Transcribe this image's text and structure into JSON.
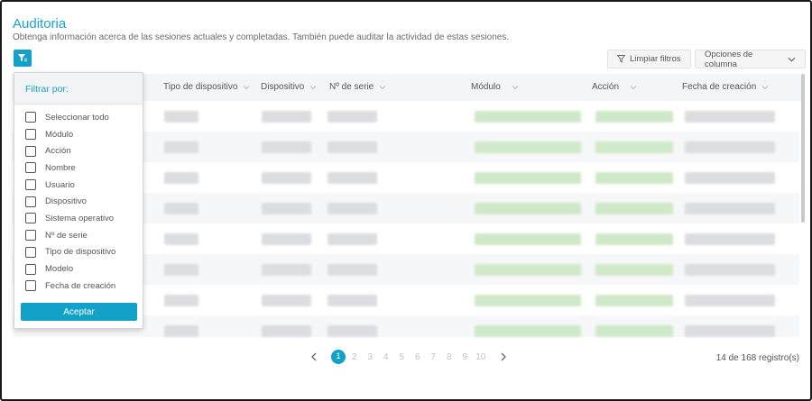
{
  "header": {
    "title": "Auditoria",
    "subtitle": "Obtenga información acerca de las sesiones actuales y completadas. También puede auditar la actividad de estas sesiones."
  },
  "toolbar": {
    "filter_icon": "filter-icon",
    "clear_filters_label": "Limpiar filtros",
    "column_options_label": "Opciones de columna"
  },
  "table": {
    "columns": [
      "Tipo de dispositivo",
      "Dispositivo",
      "Nº de serie",
      "Módulo",
      "Acción",
      "Fecha de creación"
    ]
  },
  "filter_panel": {
    "title": "Filtrar por:",
    "options": [
      "Seleccionar todo",
      "Módulo",
      "Acción",
      "Nombre",
      "Usuario",
      "Dispositivo",
      "Sistema operativo",
      "Nº de serie",
      "Tipo de dispositivo",
      "Modelo",
      "Fecha de creación"
    ],
    "accept_label": "Aceptar"
  },
  "pagination": {
    "current": "1",
    "pages": [
      "2",
      "3",
      "4",
      "5",
      "6",
      "7",
      "8",
      "9",
      "10"
    ],
    "records_text": "14 de 168 registro(s)"
  },
  "colors": {
    "accent": "#14a1c9",
    "title": "#1aa3c8"
  }
}
